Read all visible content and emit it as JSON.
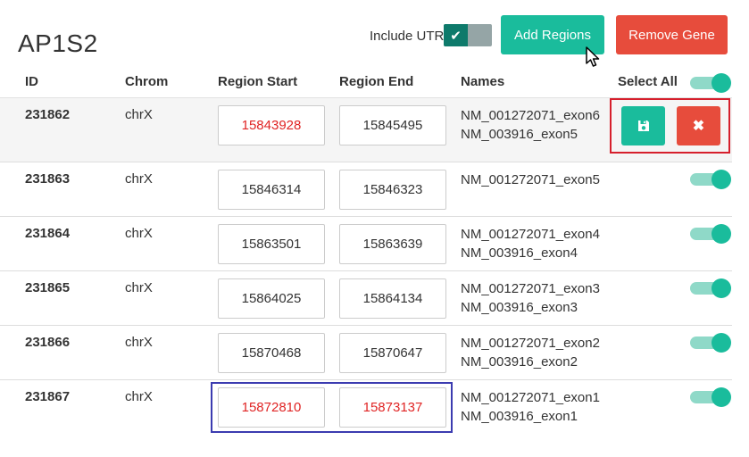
{
  "gene": {
    "title": "AP1S2"
  },
  "toolbar": {
    "include_utr_label": "Include UTR",
    "include_utr_checked": true,
    "add_regions_label": "Add Regions",
    "remove_gene_label": "Remove Gene"
  },
  "table": {
    "headers": {
      "id": "ID",
      "chrom": "Chrom",
      "region_start": "Region Start",
      "region_end": "Region End",
      "names": "Names",
      "select_all": "Select All"
    },
    "select_all_checked": true,
    "rows": [
      {
        "id": "231862",
        "chrom": "chrX",
        "start": "15843928",
        "end": "15845495",
        "start_invalid": true,
        "end_invalid": false,
        "names": [
          "NM_001272071_exon6",
          "NM_003916_exon5"
        ],
        "editing": true
      },
      {
        "id": "231863",
        "chrom": "chrX",
        "start": "15846314",
        "end": "15846323",
        "start_invalid": false,
        "end_invalid": false,
        "names": [
          "NM_001272071_exon5"
        ],
        "selected": true
      },
      {
        "id": "231864",
        "chrom": "chrX",
        "start": "15863501",
        "end": "15863639",
        "start_invalid": false,
        "end_invalid": false,
        "names": [
          "NM_001272071_exon4",
          "NM_003916_exon4"
        ],
        "selected": true
      },
      {
        "id": "231865",
        "chrom": "chrX",
        "start": "15864025",
        "end": "15864134",
        "start_invalid": false,
        "end_invalid": false,
        "names": [
          "NM_001272071_exon3",
          "NM_003916_exon3"
        ],
        "selected": true
      },
      {
        "id": "231866",
        "chrom": "chrX",
        "start": "15870468",
        "end": "15870647",
        "start_invalid": false,
        "end_invalid": false,
        "names": [
          "NM_001272071_exon2",
          "NM_003916_exon2"
        ],
        "selected": true
      },
      {
        "id": "231867",
        "chrom": "chrX",
        "start": "15872810",
        "end": "15873137",
        "start_invalid": true,
        "end_invalid": true,
        "names": [
          "NM_001272071_exon1",
          "NM_003916_exon1"
        ],
        "selected": true
      }
    ]
  },
  "icons": {
    "utr_check": "check-icon",
    "save": "floppy-disk-icon",
    "delete": "times-icon",
    "cursor": "mouse-pointer-icon"
  },
  "colors": {
    "primary": "#1abc9c",
    "danger": "#e74c3c",
    "invalid_text": "#e02424",
    "highlight_red": "#d61f2c",
    "highlight_blue": "#3b3bb0"
  }
}
